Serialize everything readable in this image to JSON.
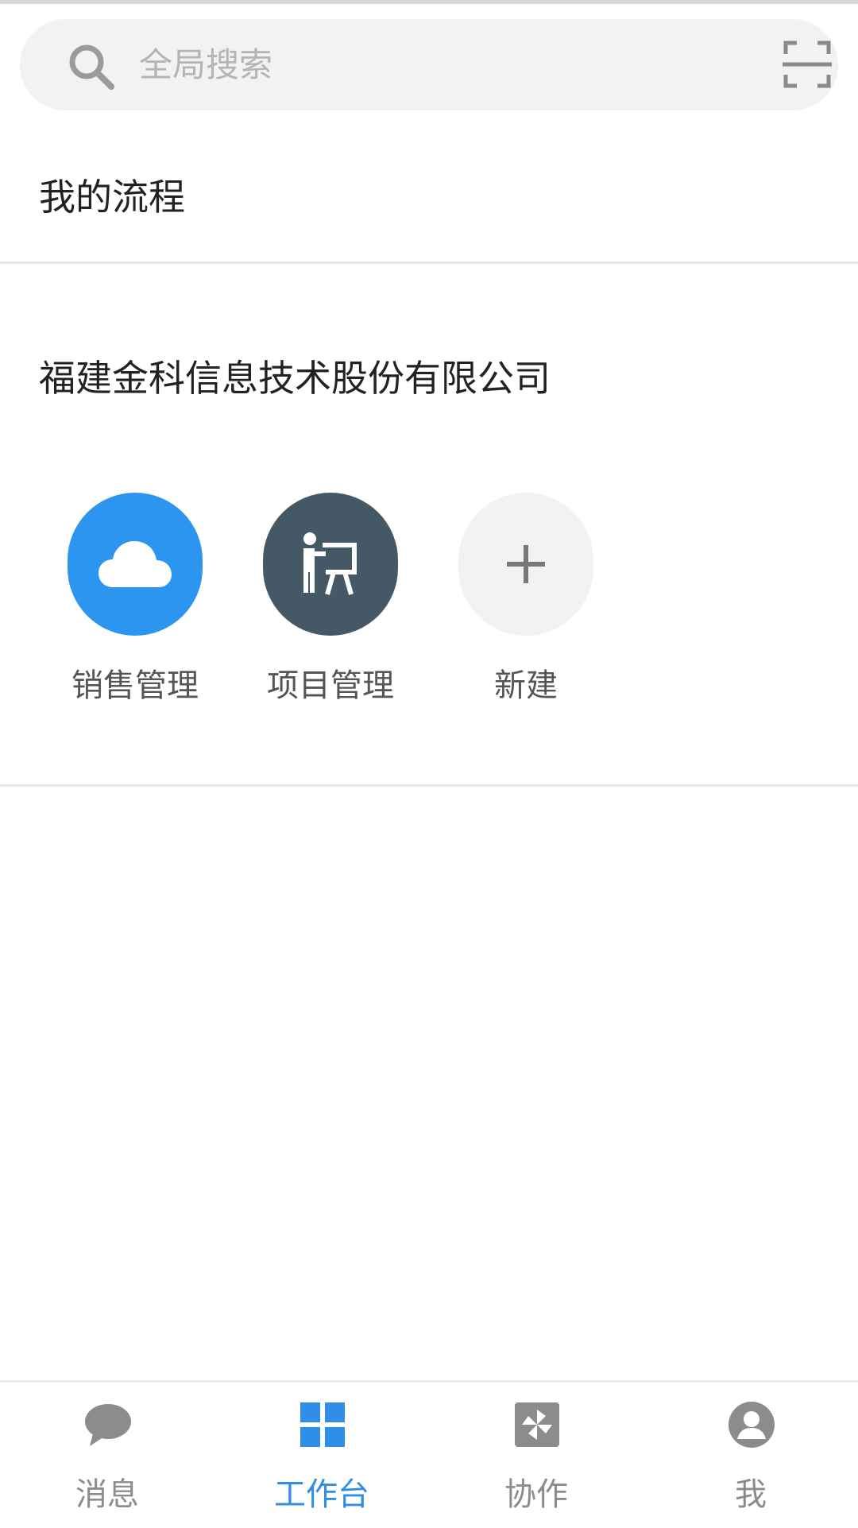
{
  "search": {
    "placeholder": "全局搜索",
    "icon": "search-icon",
    "scan_icon": "scan-icon"
  },
  "sections": {
    "my_flow_title": "我的流程",
    "company_name": "福建金科信息技术股份有限公司"
  },
  "apps": [
    {
      "label": "销售管理",
      "icon": "cloud-icon",
      "color": "#2b95f0"
    },
    {
      "label": "项目管理",
      "icon": "presentation-icon",
      "color": "#455865"
    },
    {
      "label": "新建",
      "icon": "plus-icon",
      "color": "#f2f2f2"
    }
  ],
  "bottom_nav": {
    "items": [
      {
        "label": "消息",
        "icon": "chat-bubble-icon",
        "active": false
      },
      {
        "label": "工作台",
        "icon": "grid-icon",
        "active": true
      },
      {
        "label": "协作",
        "icon": "pinwheel-icon",
        "active": false
      },
      {
        "label": "我",
        "icon": "user-icon",
        "active": false
      }
    ],
    "active_color": "#2f8fe6",
    "inactive_color": "#8c8c8c"
  }
}
